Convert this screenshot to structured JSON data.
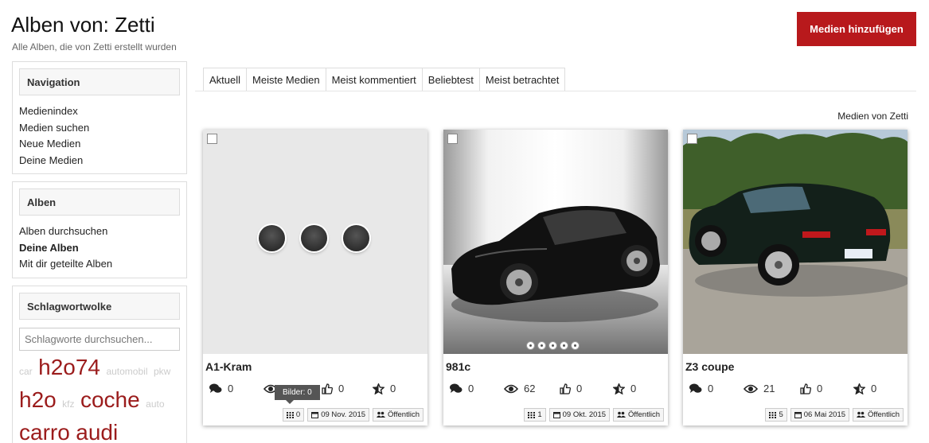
{
  "header": {
    "title": "Alben von: Zetti",
    "subtitle": "Alle Alben, die von Zetti erstellt wurden",
    "add_button": "Medien hinzufügen"
  },
  "sidebar": {
    "navigation": {
      "title": "Navigation",
      "links": [
        "Medienindex",
        "Medien suchen",
        "Neue Medien",
        "Deine Medien"
      ]
    },
    "albums": {
      "title": "Alben",
      "links": [
        "Alben durchsuchen",
        "Deine Alben",
        "Mit dir geteilte Alben"
      ],
      "active": "Deine Alben"
    },
    "tags": {
      "title": "Schlagwortwolke",
      "search_placeholder": "Schlagworte durchsuchen...",
      "cloud": [
        "car",
        "h2o74",
        "automobil",
        "pkw",
        "h2o",
        "kfz",
        "coche",
        "auto",
        "carro",
        "audi"
      ]
    }
  },
  "tabs": [
    "Aktuell",
    "Meiste Medien",
    "Meist kommentiert",
    "Beliebtest",
    "Meist betrachtet"
  ],
  "active_tab": "Aktuell",
  "media_owner_link": "Medien von Zetti",
  "albums": [
    {
      "title": "A1-Kram",
      "comments": "0",
      "views": "0",
      "likes": "0",
      "rating": "0",
      "item_count": "0",
      "date": "09 Nov. 2015",
      "privacy": "Öffentlich"
    },
    {
      "title": "981c",
      "comments": "0",
      "views": "62",
      "likes": "0",
      "rating": "0",
      "item_count": "1",
      "date": "09 Okt. 2015",
      "privacy": "Öffentlich"
    },
    {
      "title": "Z3 coupe",
      "comments": "0",
      "views": "21",
      "likes": "0",
      "rating": "0",
      "item_count": "5",
      "date": "06 Mai 2015",
      "privacy": "Öffentlich"
    }
  ],
  "tooltip": "Bilder: 0",
  "colors": {
    "accent": "#b8191c",
    "tag": "#9b1c1c"
  }
}
